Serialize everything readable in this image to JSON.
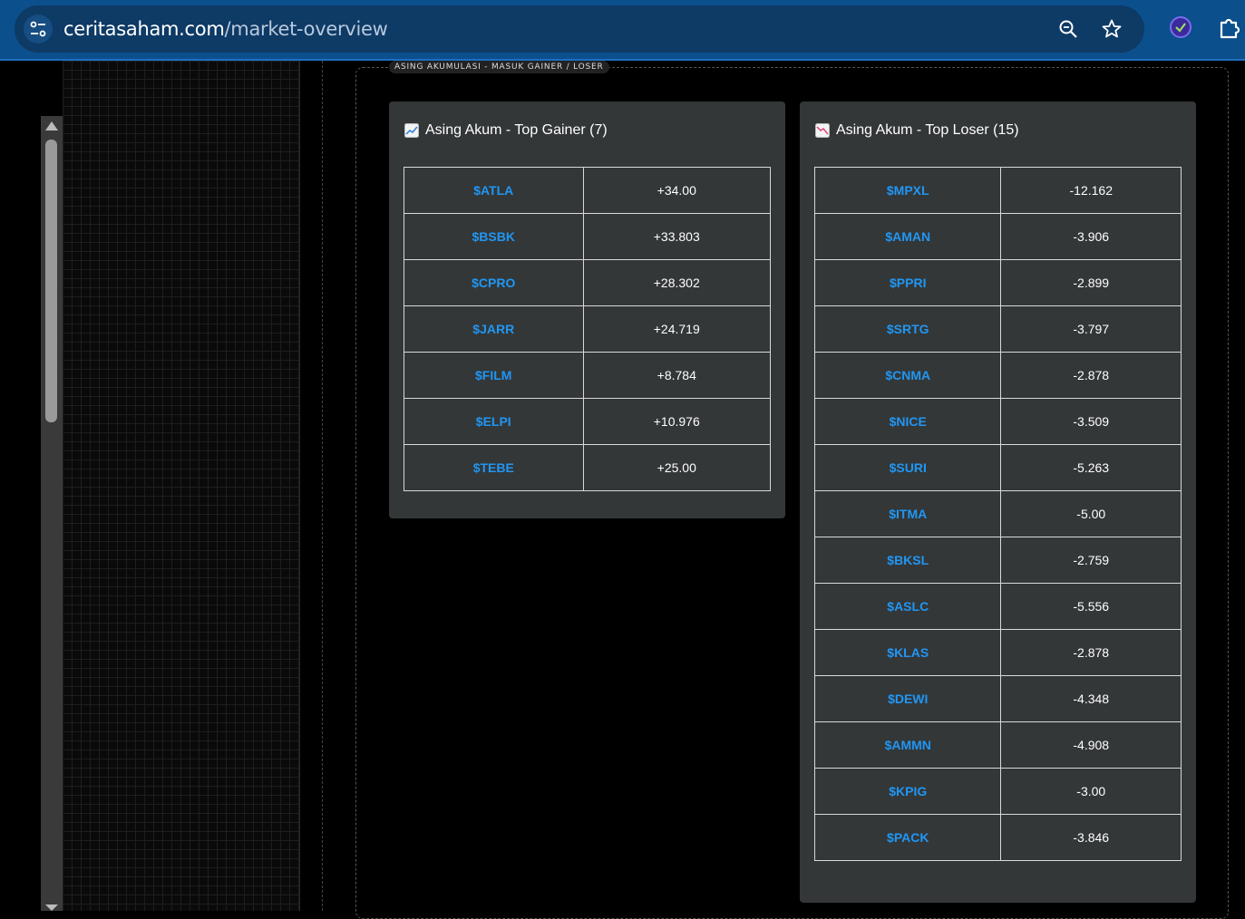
{
  "browser": {
    "url_host": "ceritasaham.com",
    "url_path": "/market-overview",
    "icons": [
      "site-info-icon",
      "zoom-icon",
      "bookmark-star-icon",
      "extension-check-icon",
      "extensions-puzzle-icon"
    ]
  },
  "section": {
    "label": "ASING AKUMULASI - MASUK GAINER / LOSER"
  },
  "gainer": {
    "title": "Asing Akum - Top Gainer (7)",
    "icon": "chart-increasing-icon",
    "rows": [
      {
        "ticker": "$ATLA",
        "value": "+34.00"
      },
      {
        "ticker": "$BSBK",
        "value": "+33.803"
      },
      {
        "ticker": "$CPRO",
        "value": "+28.302"
      },
      {
        "ticker": "$JARR",
        "value": "+24.719"
      },
      {
        "ticker": "$FILM",
        "value": "+8.784"
      },
      {
        "ticker": "$ELPI",
        "value": "+10.976"
      },
      {
        "ticker": "$TEBE",
        "value": "+25.00"
      }
    ]
  },
  "loser": {
    "title": "Asing Akum - Top Loser (15)",
    "icon": "chart-decreasing-icon",
    "rows": [
      {
        "ticker": "$MPXL",
        "value": "-12.162"
      },
      {
        "ticker": "$AMAN",
        "value": "-3.906"
      },
      {
        "ticker": "$PPRI",
        "value": "-2.899"
      },
      {
        "ticker": "$SRTG",
        "value": "-3.797"
      },
      {
        "ticker": "$CNMA",
        "value": "-2.878"
      },
      {
        "ticker": "$NICE",
        "value": "-3.509"
      },
      {
        "ticker": "$SURI",
        "value": "-5.263"
      },
      {
        "ticker": "$ITMA",
        "value": "-5.00"
      },
      {
        "ticker": "$BKSL",
        "value": "-2.759"
      },
      {
        "ticker": "$ASLC",
        "value": "-5.556"
      },
      {
        "ticker": "$KLAS",
        "value": "-2.878"
      },
      {
        "ticker": "$DEWI",
        "value": "-4.348"
      },
      {
        "ticker": "$AMMN",
        "value": "-4.908"
      },
      {
        "ticker": "$KPIG",
        "value": "-3.00"
      },
      {
        "ticker": "$PACK",
        "value": "-3.846"
      }
    ]
  },
  "colors": {
    "ticker": "#2196f3",
    "card_bg": "#333738",
    "browser_bar": "#0b4f8c"
  }
}
